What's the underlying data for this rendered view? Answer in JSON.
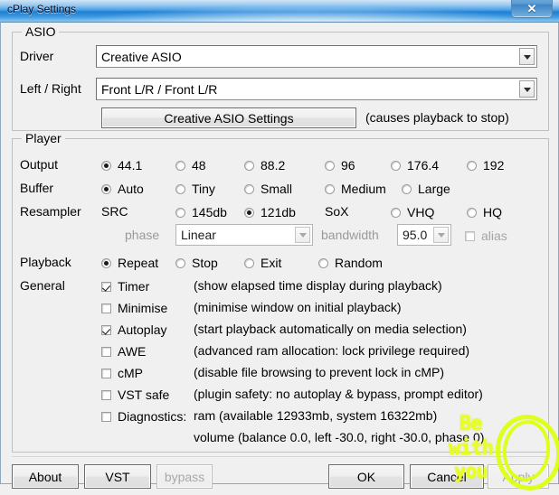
{
  "window": {
    "title": "cPlay Settings",
    "close_icon": "close-x-icon"
  },
  "asio": {
    "legend": "ASIO",
    "driver_label": "Driver",
    "driver_value": "Creative ASIO",
    "leftright_label": "Left / Right",
    "leftright_value": "Front L/R / Front L/R",
    "settings_button": "Creative ASIO Settings",
    "settings_note": "(causes playback to stop)"
  },
  "player": {
    "legend": "Player",
    "output": {
      "label": "Output",
      "options": [
        "44.1",
        "48",
        "88.2",
        "96",
        "176.4",
        "192"
      ],
      "selected": "44.1"
    },
    "buffer": {
      "label": "Buffer",
      "options": [
        "Auto",
        "Tiny",
        "Small",
        "Medium",
        "Large"
      ],
      "selected": "Auto"
    },
    "resampler": {
      "label": "Resampler",
      "src_label": "SRC",
      "sox_label": "SoX",
      "options": [
        "145db",
        "121db",
        "VHQ",
        "HQ"
      ],
      "selected": "121db"
    },
    "phase": {
      "label": "phase",
      "value": "Linear"
    },
    "bandwidth": {
      "label": "bandwidth",
      "value": "95.0"
    },
    "alias": {
      "label": "alias",
      "checked": false
    },
    "playback": {
      "label": "Playback",
      "options": [
        "Repeat",
        "Stop",
        "Exit",
        "Random"
      ],
      "selected": "Repeat"
    },
    "general": {
      "label": "General",
      "items": [
        {
          "label": "Timer",
          "checked": true,
          "note": "(show elapsed time display during playback)"
        },
        {
          "label": "Minimise",
          "checked": false,
          "note": "(minimise window on initial playback)"
        },
        {
          "label": "Autoplay",
          "checked": true,
          "note": "(start playback automatically on media selection)"
        },
        {
          "label": "AWE",
          "checked": false,
          "note": "(advanced ram allocation: lock privilege required)"
        },
        {
          "label": "cMP",
          "checked": false,
          "note": "(disable file browsing to prevent lock in cMP)"
        },
        {
          "label": "VST safe",
          "checked": false,
          "note": "(plugin safety: no autoplay & bypass, prompt editor)"
        },
        {
          "label": "Diagnostics:",
          "checked": false,
          "note": "ram (available 12933mb, system 16322mb)"
        }
      ],
      "volume_line": "volume (balance  0.0, left -30.0, right -30.0, phase 0)"
    }
  },
  "footer": {
    "about": "About",
    "vst": "VST",
    "bypass": "bypass",
    "ok": "OK",
    "cancel": "Cancel",
    "apply": "Apply"
  },
  "annotation": {
    "line1": "Be",
    "line2": "with",
    "line3": "you",
    "color": "#ddff12"
  }
}
